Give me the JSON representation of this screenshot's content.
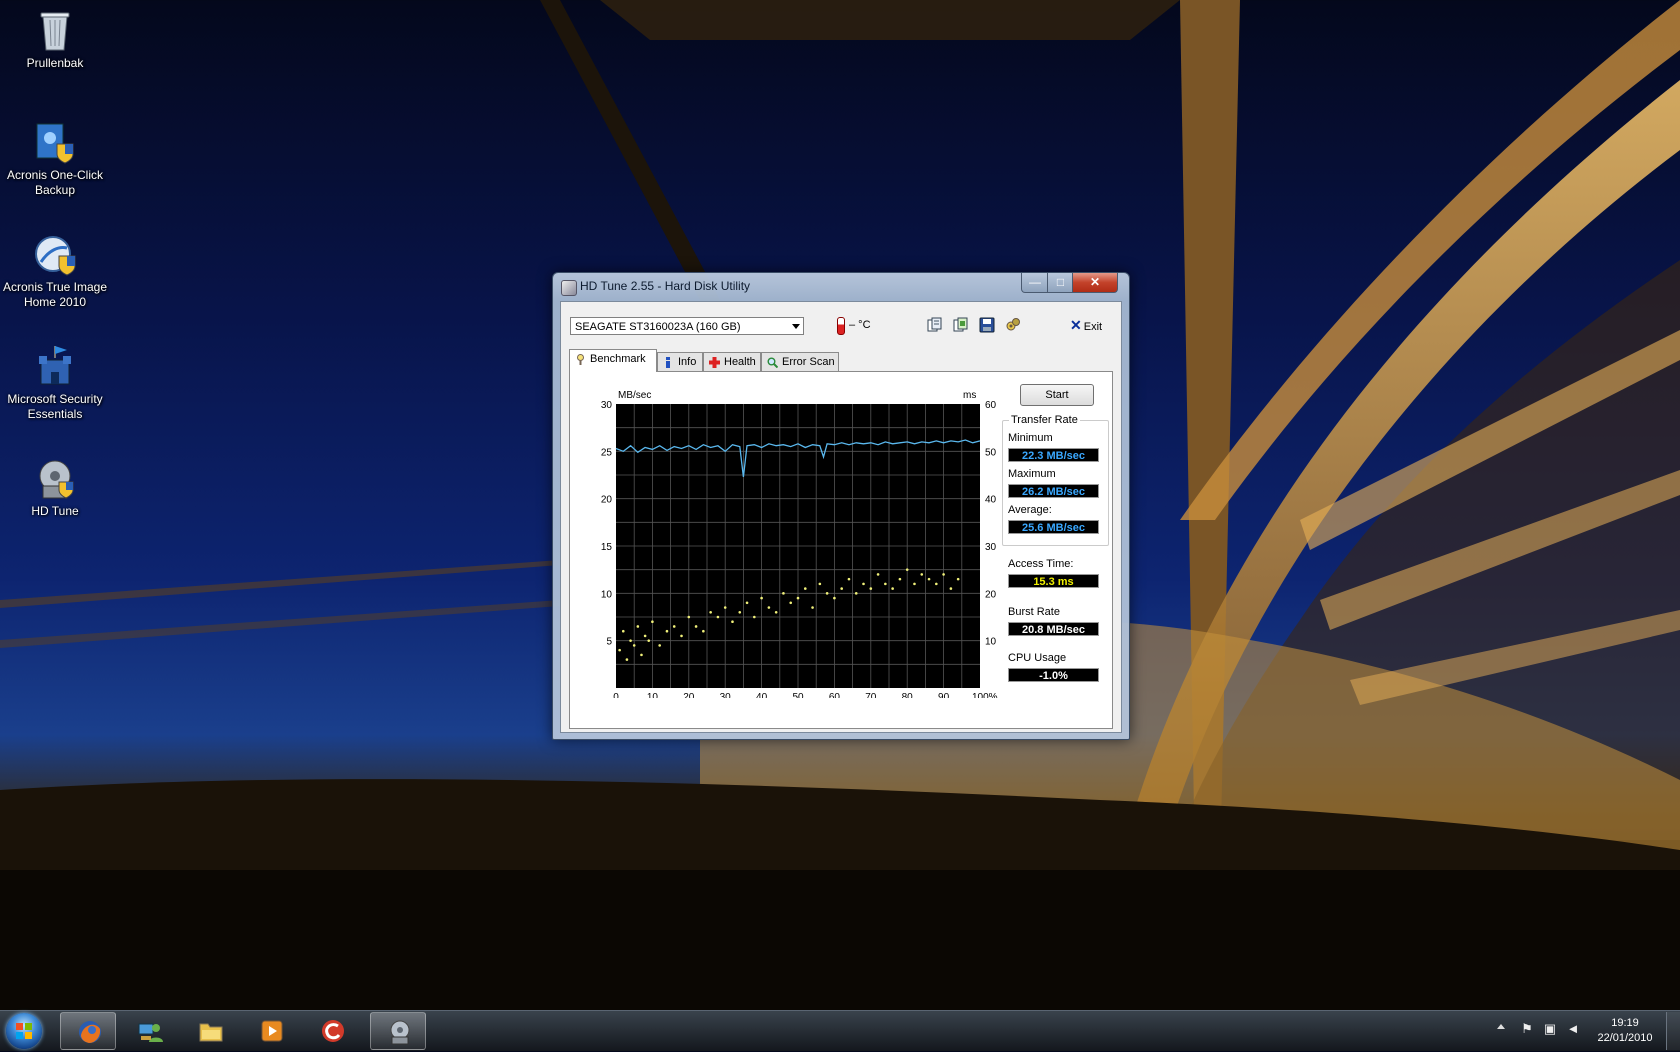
{
  "desktop": {
    "icons": [
      {
        "label": "Prullenbak",
        "icon": "recycle-bin-icon"
      },
      {
        "label": "Acronis One-Click Backup",
        "icon": "acronis-backup-icon"
      },
      {
        "label": "Acronis True Image Home 2010",
        "icon": "acronis-true-image-icon"
      },
      {
        "label": "Microsoft Security Essentials",
        "icon": "security-essentials-icon"
      },
      {
        "label": "HD Tune",
        "icon": "hd-tune-icon"
      }
    ]
  },
  "window": {
    "title": "HD Tune 2.55 - Hard Disk Utility",
    "controls": {
      "minimize": "—",
      "maximize": "□",
      "close": "✕"
    },
    "drive": "SEAGATE ST3160023A (160 GB)",
    "temperature": "– °C",
    "exit_label": "Exit",
    "toolbar_icons": [
      "copy-info-icon",
      "copy-screenshot-icon",
      "save-icon",
      "options-icon"
    ],
    "tabs": [
      {
        "label": "Benchmark",
        "icon": "benchmark-icon",
        "active": true
      },
      {
        "label": "Info",
        "icon": "info-icon",
        "active": false
      },
      {
        "label": "Health",
        "icon": "health-icon",
        "active": false
      },
      {
        "label": "Error Scan",
        "icon": "error-scan-icon",
        "active": false
      }
    ],
    "benchmark": {
      "start_label": "Start",
      "transfer_rate_label": "Transfer Rate",
      "minimum_label": "Minimum",
      "minimum_value": "22.3 MB/sec",
      "maximum_label": "Maximum",
      "maximum_value": "26.2 MB/sec",
      "average_label": "Average:",
      "average_value": "25.6 MB/sec",
      "access_time_label": "Access Time:",
      "access_time_value": "15.3 ms",
      "burst_rate_label": "Burst Rate",
      "burst_rate_value": "20.8 MB/sec",
      "cpu_usage_label": "CPU Usage",
      "cpu_usage_value": "-1.0%",
      "colors": {
        "transfer": "#5ab8ee",
        "access": "#f0f07a",
        "value_blue": "#3aa8ff",
        "value_yellow": "#f0f000",
        "value_white": "#ffffff"
      }
    }
  },
  "chart_data": {
    "type": "line",
    "title": "",
    "xlabel": "",
    "ylabel": "MB/sec",
    "y2label": "ms",
    "xlim": [
      0,
      100
    ],
    "ylim": [
      0,
      30
    ],
    "y2lim": [
      0,
      60
    ],
    "x_ticks": [
      "0",
      "10",
      "20",
      "30",
      "40",
      "50",
      "60",
      "70",
      "80",
      "90",
      "100%"
    ],
    "y_ticks": [
      "5",
      "10",
      "15",
      "20",
      "25",
      "30"
    ],
    "y2_ticks": [
      "10",
      "20",
      "30",
      "40",
      "50",
      "60"
    ],
    "grid": true,
    "series": [
      {
        "name": "Transfer Rate",
        "axis": "left",
        "x": [
          0,
          2,
          4,
          6,
          8,
          10,
          12,
          14,
          16,
          18,
          20,
          22,
          24,
          26,
          28,
          30,
          32,
          34,
          35,
          36,
          38,
          40,
          42,
          44,
          46,
          48,
          50,
          52,
          54,
          56,
          57,
          58,
          60,
          62,
          64,
          66,
          68,
          70,
          72,
          74,
          76,
          78,
          80,
          82,
          84,
          86,
          88,
          90,
          92,
          94,
          96,
          98,
          100
        ],
        "values": [
          25.3,
          25.0,
          25.6,
          24.9,
          25.4,
          25.2,
          25.6,
          25.1,
          25.5,
          25.3,
          25.6,
          25.2,
          25.7,
          25.4,
          25.6,
          25.0,
          25.7,
          25.5,
          22.3,
          25.6,
          25.7,
          25.4,
          25.8,
          25.6,
          25.7,
          25.5,
          25.8,
          25.4,
          25.7,
          25.6,
          24.4,
          25.8,
          25.7,
          25.9,
          25.7,
          25.9,
          25.8,
          25.9,
          25.7,
          26.0,
          25.8,
          25.9,
          26.0,
          25.8,
          26.0,
          25.9,
          26.1,
          25.9,
          26.1,
          26.0,
          26.2,
          25.9,
          26.1
        ]
      },
      {
        "name": "Access Time",
        "type": "scatter",
        "axis": "right",
        "x": [
          1,
          2,
          3,
          4,
          5,
          6,
          7,
          8,
          9,
          10,
          12,
          14,
          16,
          18,
          20,
          22,
          24,
          26,
          28,
          30,
          32,
          34,
          36,
          38,
          40,
          42,
          44,
          46,
          48,
          50,
          52,
          54,
          56,
          58,
          60,
          62,
          64,
          66,
          68,
          70,
          72,
          74,
          76,
          78,
          80,
          82,
          84,
          86,
          88,
          90,
          92,
          94
        ],
        "values": [
          8,
          12,
          6,
          10,
          9,
          13,
          7,
          11,
          10,
          14,
          9,
          12,
          13,
          11,
          15,
          13,
          12,
          16,
          15,
          17,
          14,
          16,
          18,
          15,
          19,
          17,
          16,
          20,
          18,
          19,
          21,
          17,
          22,
          20,
          19,
          21,
          23,
          20,
          22,
          21,
          24,
          22,
          21,
          23,
          25,
          22,
          24,
          23,
          22,
          24,
          21,
          23
        ]
      }
    ]
  },
  "taskbar": {
    "apps": [
      "firefox-icon",
      "network-contacts-icon",
      "file-explorer-icon",
      "media-player-icon",
      "ccleaner-icon",
      "hd-tune-icon"
    ],
    "time": "19:19",
    "date": "22/01/2010"
  }
}
